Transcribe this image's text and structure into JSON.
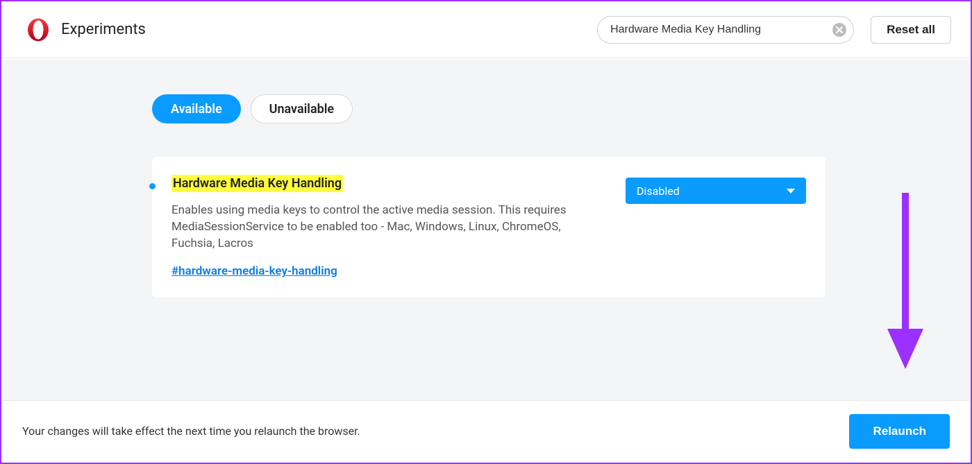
{
  "header": {
    "title": "Experiments",
    "search_value": "Hardware Media Key Handling",
    "reset_label": "Reset all"
  },
  "tabs": {
    "available": "Available",
    "unavailable": "Unavailable",
    "active": "available"
  },
  "flag": {
    "title": "Hardware Media Key Handling",
    "description": "Enables using media keys to control the active media session. This requires MediaSessionService to be enabled too - Mac, Windows, Linux, ChromeOS, Fuchsia, Lacros",
    "link_text": "#hardware-media-key-handling",
    "dropdown_value": "Disabled"
  },
  "footer": {
    "message": "Your changes will take effect the next time you relaunch the browser.",
    "relaunch_label": "Relaunch"
  },
  "colors": {
    "accent_blue": "#0a9bff",
    "highlight_yellow": "#ffff3c",
    "annotation_purple": "#9b30ff"
  }
}
